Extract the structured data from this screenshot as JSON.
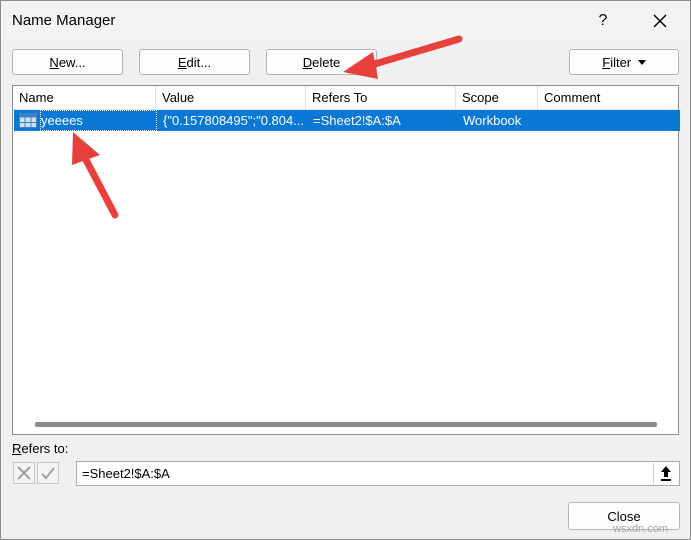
{
  "window": {
    "title": "Name Manager",
    "help_label": "?"
  },
  "toolbar": {
    "new_prefix": "",
    "new_accel": "N",
    "new_rest": "ew...",
    "edit_prefix": "",
    "edit_accel": "E",
    "edit_rest": "dit...",
    "delete_prefix": "",
    "delete_accel": "D",
    "delete_rest": "elete",
    "filter_prefix": "",
    "filter_accel": "F",
    "filter_rest": "ilter"
  },
  "table": {
    "columns": [
      "Name",
      "Value",
      "Refers To",
      "Scope",
      "Comment"
    ],
    "rows": [
      {
        "name": "yeeees",
        "value": "{\"0.157808495\";\"0.804...",
        "refers_to": "=Sheet2!$A:$A",
        "scope": "Workbook",
        "comment": ""
      }
    ]
  },
  "refers": {
    "label_accel": "R",
    "label_rest": "efers to:",
    "value": "=Sheet2!$A:$A"
  },
  "footer": {
    "close_label": "Close"
  },
  "watermark": "wsxdn.com",
  "colors": {
    "selection": "#0a78d7",
    "annotation_arrow": "#e8413b"
  }
}
